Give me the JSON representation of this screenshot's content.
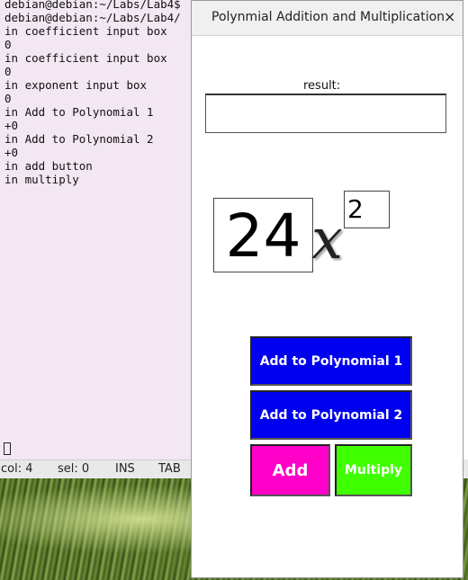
{
  "terminal": {
    "lines": [
      "debian@debian:~/Labs/Lab4$",
      "debian@debian:~/Labs/Lab4/",
      "in coefficient input box",
      "0",
      "in coefficient input box",
      "0",
      "in exponent input box",
      "0",
      "in Add to Polynomial 1",
      "+0",
      "in Add to Polynomial 2",
      "+0",
      "in add button",
      "in multiply"
    ],
    "status": {
      "col": "col: 4",
      "sel": "sel: 0",
      "mode": "INS",
      "tab": "TAB"
    }
  },
  "dialog": {
    "title": "Polynmial Addition and Multiplication",
    "close_glyph": "×",
    "result_label": "result:",
    "result_value": "",
    "coefficient": "24",
    "variable": "x",
    "exponent": "2",
    "buttons": {
      "add_poly1": "Add to Polynomial 1",
      "add_poly2": "Add to Polynomial 2",
      "add": "Add",
      "multiply": "Multiply"
    }
  },
  "colors": {
    "poly_buttons": "#0000f0",
    "add_button": "#ff00c8",
    "multiply_button": "#40ff00",
    "terminal_bg": "#f2e7f2"
  }
}
